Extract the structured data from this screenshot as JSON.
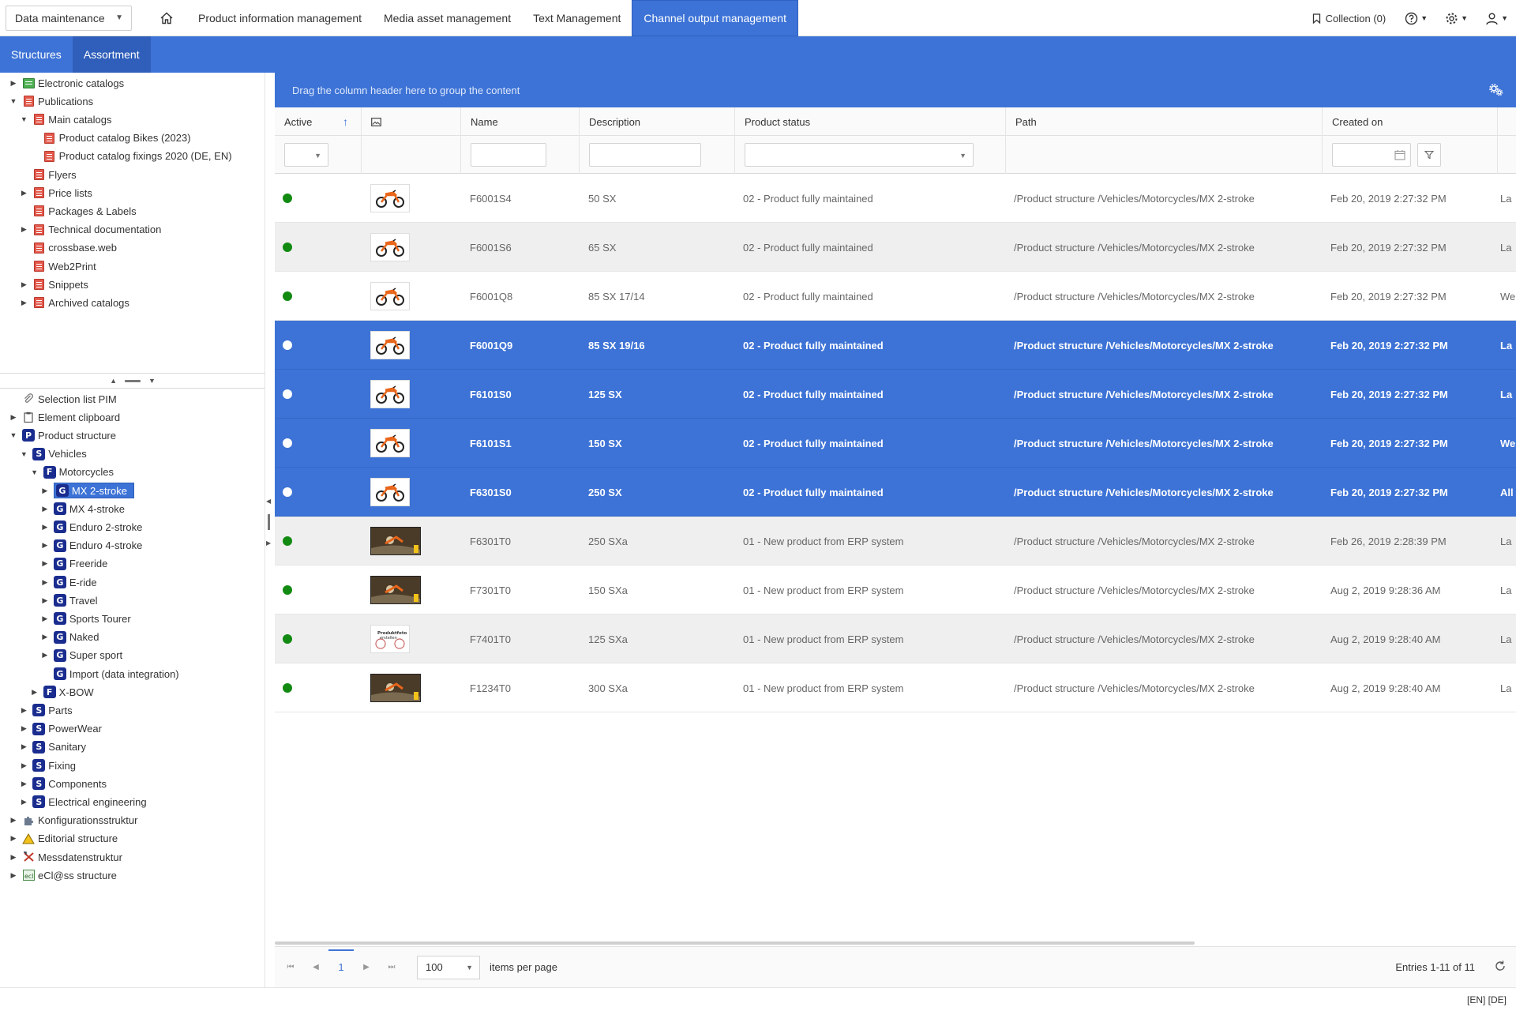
{
  "topbar": {
    "mode_select": "Data maintenance",
    "nav_tabs": [
      {
        "label": "Product information management",
        "active": false
      },
      {
        "label": "Media asset management",
        "active": false
      },
      {
        "label": "Text Management",
        "active": false
      },
      {
        "label": "Channel output management",
        "active": true
      }
    ],
    "collection_label": "Collection (0)",
    "icons": [
      "home-icon",
      "bookmark-icon",
      "help-icon",
      "gear-icon",
      "user-icon"
    ]
  },
  "structure_tabs": [
    {
      "label": "Structures",
      "active": false
    },
    {
      "label": "Assortment",
      "active": true
    }
  ],
  "tree_top": [
    {
      "label": "Electronic catalogs",
      "level": 0,
      "expander": "collapsed",
      "icon": "green-catalog-icon"
    },
    {
      "label": "Publications",
      "level": 0,
      "expander": "expanded",
      "icon": "red-catalog-icon"
    },
    {
      "label": "Main catalogs",
      "level": 1,
      "expander": "expanded",
      "icon": "red-catalog-icon"
    },
    {
      "label": "Product catalog Bikes (2023)",
      "level": 2,
      "expander": "none",
      "icon": "red-catalog-icon"
    },
    {
      "label": "Product catalog fixings 2020 (DE, EN)",
      "level": 2,
      "expander": "none",
      "icon": "red-catalog-icon"
    },
    {
      "label": "Flyers",
      "level": 1,
      "expander": "none",
      "icon": "red-catalog-icon"
    },
    {
      "label": "Price lists",
      "level": 1,
      "expander": "collapsed",
      "icon": "red-catalog-icon"
    },
    {
      "label": "Packages & Labels",
      "level": 1,
      "expander": "none",
      "icon": "red-catalog-icon"
    },
    {
      "label": "Technical documentation",
      "level": 1,
      "expander": "collapsed",
      "icon": "red-catalog-icon"
    },
    {
      "label": "crossbase.web",
      "level": 1,
      "expander": "none",
      "icon": "red-catalog-icon"
    },
    {
      "label": "Web2Print",
      "level": 1,
      "expander": "none",
      "icon": "red-catalog-icon"
    },
    {
      "label": "Snippets",
      "level": 1,
      "expander": "collapsed",
      "icon": "red-catalog-icon"
    },
    {
      "label": "Archived catalogs",
      "level": 1,
      "expander": "collapsed",
      "icon": "red-catalog-icon"
    }
  ],
  "tree_bottom": [
    {
      "label": "Selection list PIM",
      "level": 0,
      "expander": "none",
      "icon": "paperclip-icon"
    },
    {
      "label": "Element clipboard",
      "level": 0,
      "expander": "collapsed",
      "icon": "clipboard-icon"
    },
    {
      "label": "Product structure",
      "level": 0,
      "expander": "expanded",
      "badge": "P"
    },
    {
      "label": "Vehicles",
      "level": 1,
      "expander": "expanded",
      "badge": "S"
    },
    {
      "label": "Motorcycles",
      "level": 2,
      "expander": "expanded",
      "badge": "F"
    },
    {
      "label": "MX 2-stroke",
      "level": 3,
      "expander": "collapsed",
      "badge": "G",
      "selected": true
    },
    {
      "label": "MX 4-stroke",
      "level": 3,
      "expander": "collapsed",
      "badge": "G"
    },
    {
      "label": "Enduro 2-stroke",
      "level": 3,
      "expander": "collapsed",
      "badge": "G"
    },
    {
      "label": "Enduro 4-stroke",
      "level": 3,
      "expander": "collapsed",
      "badge": "G"
    },
    {
      "label": "Freeride",
      "level": 3,
      "expander": "collapsed",
      "badge": "G"
    },
    {
      "label": "E-ride",
      "level": 3,
      "expander": "collapsed",
      "badge": "G"
    },
    {
      "label": "Travel",
      "level": 3,
      "expander": "collapsed",
      "badge": "G"
    },
    {
      "label": "Sports Tourer",
      "level": 3,
      "expander": "collapsed",
      "badge": "G"
    },
    {
      "label": "Naked",
      "level": 3,
      "expander": "collapsed",
      "badge": "G"
    },
    {
      "label": "Super sport",
      "level": 3,
      "expander": "collapsed",
      "badge": "G"
    },
    {
      "label": "Import (data integration)",
      "level": 3,
      "expander": "none",
      "badge": "G"
    },
    {
      "label": "X-BOW",
      "level": 2,
      "expander": "collapsed",
      "badge": "F"
    },
    {
      "label": "Parts",
      "level": 1,
      "expander": "collapsed",
      "badge": "S"
    },
    {
      "label": "PowerWear",
      "level": 1,
      "expander": "collapsed",
      "badge": "S"
    },
    {
      "label": "Sanitary",
      "level": 1,
      "expander": "collapsed",
      "badge": "S"
    },
    {
      "label": "Fixing",
      "level": 1,
      "expander": "collapsed",
      "badge": "S"
    },
    {
      "label": "Components",
      "level": 1,
      "expander": "collapsed",
      "badge": "S"
    },
    {
      "label": "Electrical engineering",
      "level": 1,
      "expander": "collapsed",
      "badge": "S"
    },
    {
      "label": "Konfigurationsstruktur",
      "level": 0,
      "expander": "collapsed",
      "icon": "puzzle-icon"
    },
    {
      "label": "Editorial structure",
      "level": 0,
      "expander": "collapsed",
      "icon": "warning-triangle-icon"
    },
    {
      "label": "Messdatenstruktur",
      "level": 0,
      "expander": "collapsed",
      "icon": "tools-icon"
    },
    {
      "label": "eCl@ss structure",
      "level": 0,
      "expander": "collapsed",
      "icon": "eclass-icon"
    }
  ],
  "grid": {
    "group_hint": "Drag the column header here to group the content",
    "columns": [
      "Active",
      "",
      "Name",
      "Description",
      "Product status",
      "Path",
      "Created on"
    ],
    "sort_column": "Active",
    "sort_direction": "ascending",
    "rows": [
      {
        "active": true,
        "thumb": "white",
        "name": "F6001S4",
        "description": "50 SX",
        "status": "02 - Product fully maintained",
        "path": "/Product structure /Vehicles/Motorcycles/MX 2-stroke",
        "created": "Feb 20, 2019 2:27:32 PM",
        "extra": "La",
        "selected": false
      },
      {
        "active": true,
        "thumb": "white",
        "name": "F6001S6",
        "description": "65 SX",
        "status": "02 - Product fully maintained",
        "path": "/Product structure /Vehicles/Motorcycles/MX 2-stroke",
        "created": "Feb 20, 2019 2:27:32 PM",
        "extra": "La",
        "selected": false
      },
      {
        "active": true,
        "thumb": "white",
        "name": "F6001Q8",
        "description": "85 SX 17/14",
        "status": "02 - Product fully maintained",
        "path": "/Product structure /Vehicles/Motorcycles/MX 2-stroke",
        "created": "Feb 20, 2019 2:27:32 PM",
        "extra": "We",
        "selected": false
      },
      {
        "active": true,
        "thumb": "white",
        "name": "F6001Q9",
        "description": "85 SX 19/16",
        "status": "02 - Product fully maintained",
        "path": "/Product structure /Vehicles/Motorcycles/MX 2-stroke",
        "created": "Feb 20, 2019 2:27:32 PM",
        "extra": "La",
        "selected": true
      },
      {
        "active": true,
        "thumb": "white",
        "name": "F6101S0",
        "description": "125 SX",
        "status": "02 - Product fully maintained",
        "path": "/Product structure /Vehicles/Motorcycles/MX 2-stroke",
        "created": "Feb 20, 2019 2:27:32 PM",
        "extra": "La",
        "selected": true
      },
      {
        "active": true,
        "thumb": "white",
        "name": "F6101S1",
        "description": "150 SX",
        "status": "02 - Product fully maintained",
        "path": "/Product structure /Vehicles/Motorcycles/MX 2-stroke",
        "created": "Feb 20, 2019 2:27:32 PM",
        "extra": "We",
        "selected": true
      },
      {
        "active": true,
        "thumb": "white",
        "name": "F6301S0",
        "description": "250 SX",
        "status": "02 - Product fully maintained",
        "path": "/Product structure /Vehicles/Motorcycles/MX 2-stroke",
        "created": "Feb 20, 2019 2:27:32 PM",
        "extra": "All",
        "selected": true
      },
      {
        "active": true,
        "thumb": "dark",
        "name": "F6301T0",
        "description": "250 SXa",
        "status": "01 - New product from ERP system",
        "path": "/Product structure /Vehicles/Motorcycles/MX 2-stroke",
        "created": "Feb 26, 2019 2:28:39 PM",
        "extra": "La",
        "selected": false
      },
      {
        "active": true,
        "thumb": "dark",
        "name": "F7301T0",
        "description": "150 SXa",
        "status": "01 - New product from ERP system",
        "path": "/Product structure /Vehicles/Motorcycles/MX 2-stroke",
        "created": "Aug 2, 2019 9:28:36 AM",
        "extra": "La",
        "selected": false
      },
      {
        "active": true,
        "thumb": "placeholder",
        "name": "F7401T0",
        "description": "125 SXa",
        "status": "01 - New product from ERP system",
        "path": "/Product structure /Vehicles/Motorcycles/MX 2-stroke",
        "created": "Aug 2, 2019 9:28:40 AM",
        "extra": "La",
        "selected": false
      },
      {
        "active": true,
        "thumb": "dark",
        "name": "F1234T0",
        "description": "300 SXa",
        "status": "01 - New product from ERP system",
        "path": "/Product structure /Vehicles/Motorcycles/MX 2-stroke",
        "created": "Aug 2, 2019 9:28:40 AM",
        "extra": "La",
        "selected": false
      }
    ]
  },
  "pager": {
    "current_page": "1",
    "page_size": "100",
    "items_per_page_label": "items per page",
    "entries_label": "Entries 1-11 of 11"
  },
  "status_bar": {
    "languages": "[EN] [DE]"
  },
  "colors": {
    "accent": "#3d73d6",
    "active_dot": "#128a12",
    "badge": "#1a2d8f"
  }
}
